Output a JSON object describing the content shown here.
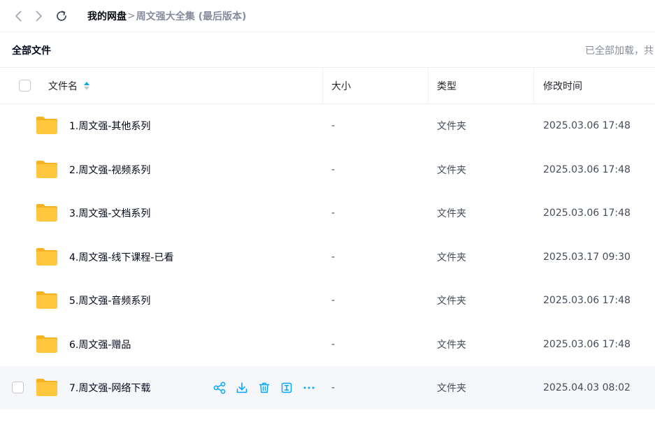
{
  "breadcrumb": {
    "root": "我的网盘",
    "separator": ">",
    "current": "周文强大全集 (最后版本)"
  },
  "section": {
    "title": "全部文件",
    "loaded_text": "已全部加载，共"
  },
  "table": {
    "headers": {
      "name": "文件名",
      "size": "大小",
      "type": "类型",
      "modified": "修改时间"
    },
    "rows": [
      {
        "name": "1.周文强-其他系列",
        "size": "-",
        "type": "文件夹",
        "modified": "2025.03.06 17:48"
      },
      {
        "name": "2.周文强-视频系列",
        "size": "-",
        "type": "文件夹",
        "modified": "2025.03.06 17:48"
      },
      {
        "name": "3.周文强-文档系列",
        "size": "-",
        "type": "文件夹",
        "modified": "2025.03.06 17:48"
      },
      {
        "name": "4.周文强-线下课程-已看",
        "size": "-",
        "type": "文件夹",
        "modified": "2025.03.17 09:30"
      },
      {
        "name": "5.周文强-音频系列",
        "size": "-",
        "type": "文件夹",
        "modified": "2025.03.06 17:48"
      },
      {
        "name": "6.周文强-赠品",
        "size": "-",
        "type": "文件夹",
        "modified": "2025.03.06 17:48"
      },
      {
        "name": "7.周文强-网络下载",
        "size": "-",
        "type": "文件夹",
        "modified": "2025.04.03 08:02"
      }
    ]
  },
  "colors": {
    "accent": "#06a7ff",
    "folder": "#ffc73d",
    "folder_tab": "#f5b324",
    "hover_row": "#f6f7fa"
  },
  "icons": {
    "nav": [
      "back-icon",
      "forward-icon",
      "refresh-icon"
    ],
    "row_actions": [
      "share-icon",
      "download-icon",
      "delete-icon",
      "rename-icon",
      "more-icon"
    ],
    "file": "folder-icon",
    "sort": "sort-icon"
  }
}
